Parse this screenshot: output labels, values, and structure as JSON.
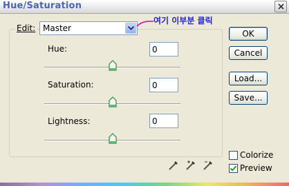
{
  "window": {
    "title": "Hue/Saturation"
  },
  "edit": {
    "label": "Edit:",
    "selected": "Master"
  },
  "annotation": {
    "text": "여기 이부분 클릭",
    "color": "#1f22e0"
  },
  "hue": {
    "label": "Hue:",
    "value": "0",
    "slider_fraction": 0.5
  },
  "saturation": {
    "label": "Saturation:",
    "value": "0",
    "slider_fraction": 0.5
  },
  "lightness": {
    "label": "Lightness:",
    "value": "0",
    "slider_fraction": 0.5
  },
  "buttons": {
    "ok": "OK",
    "cancel": "Cancel",
    "load": "Load...",
    "save": "Save..."
  },
  "colorize": {
    "label": "Colorize",
    "checked": false
  },
  "preview": {
    "label": "Preview",
    "checked": true
  },
  "icons": [
    "close-icon",
    "dropdown-arrow-icon",
    "eyedropper-icon",
    "eyedropper-plus-icon",
    "eyedropper-minus-icon",
    "slider-thumb-icon",
    "checkmark-icon"
  ]
}
